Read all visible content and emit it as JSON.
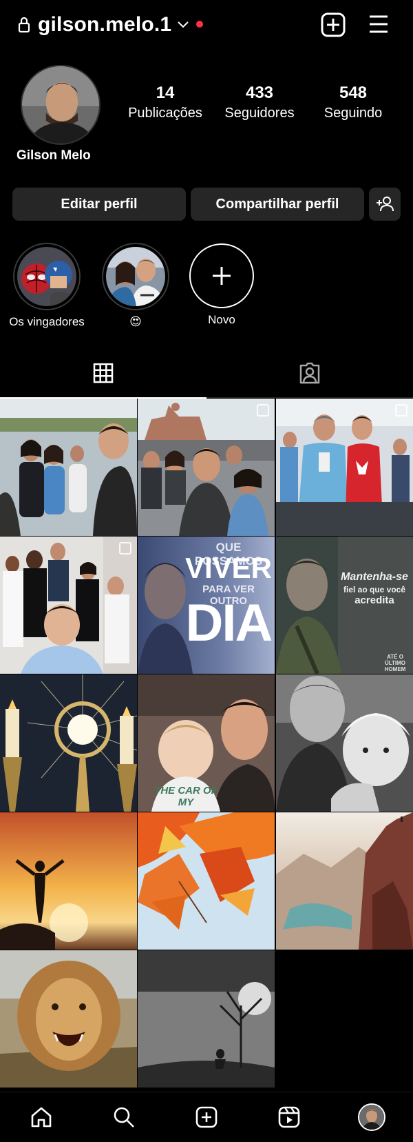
{
  "header": {
    "username": "gilson.melo.1",
    "icons": [
      "lock-icon",
      "chevron-down-icon",
      "notification-dot",
      "create-icon",
      "menu-icon"
    ],
    "notification_color": "#ff3040"
  },
  "profile": {
    "display_name": "Gilson Melo",
    "stats": [
      {
        "value": "14",
        "label": "Publicações"
      },
      {
        "value": "433",
        "label": "Seguidores"
      },
      {
        "value": "548",
        "label": "Seguindo"
      }
    ]
  },
  "buttons": {
    "edit": "Editar perfil",
    "share": "Compartilhar perfil",
    "add_icon": "add-person-icon"
  },
  "stories": [
    {
      "label": "Os vingadores"
    },
    {
      "label": "😍"
    },
    {
      "label": "Novo"
    }
  ],
  "tabs": [
    {
      "name": "grid",
      "icon": "grid-icon",
      "active": true
    },
    {
      "name": "tagged",
      "icon": "tagged-person-icon",
      "active": false
    }
  ],
  "posts": [
    {
      "id": 1,
      "caption_text": ""
    },
    {
      "id": 2,
      "caption_text": ""
    },
    {
      "id": 3,
      "caption_text": ""
    },
    {
      "id": 4,
      "caption_text": ""
    },
    {
      "id": 5,
      "lines": [
        "QUE POSSAMOS",
        "VIVER",
        "PARA VER OUTRO",
        "DIA"
      ]
    },
    {
      "id": 6,
      "lines": [
        "Mantenha-se",
        "fiel ao que você",
        "acredita",
        "ATÉ O ÚLTIMO HOMEM"
      ]
    },
    {
      "id": 7
    },
    {
      "id": 8,
      "shirt_text": "THE CAR OF MY"
    },
    {
      "id": 9
    },
    {
      "id": 10
    },
    {
      "id": 11
    },
    {
      "id": 12
    },
    {
      "id": 13
    },
    {
      "id": 14
    }
  ],
  "bottom_nav": [
    {
      "icon": "home-icon"
    },
    {
      "icon": "search-icon"
    },
    {
      "icon": "create-icon"
    },
    {
      "icon": "reels-icon"
    },
    {
      "icon": "profile-avatar"
    }
  ]
}
